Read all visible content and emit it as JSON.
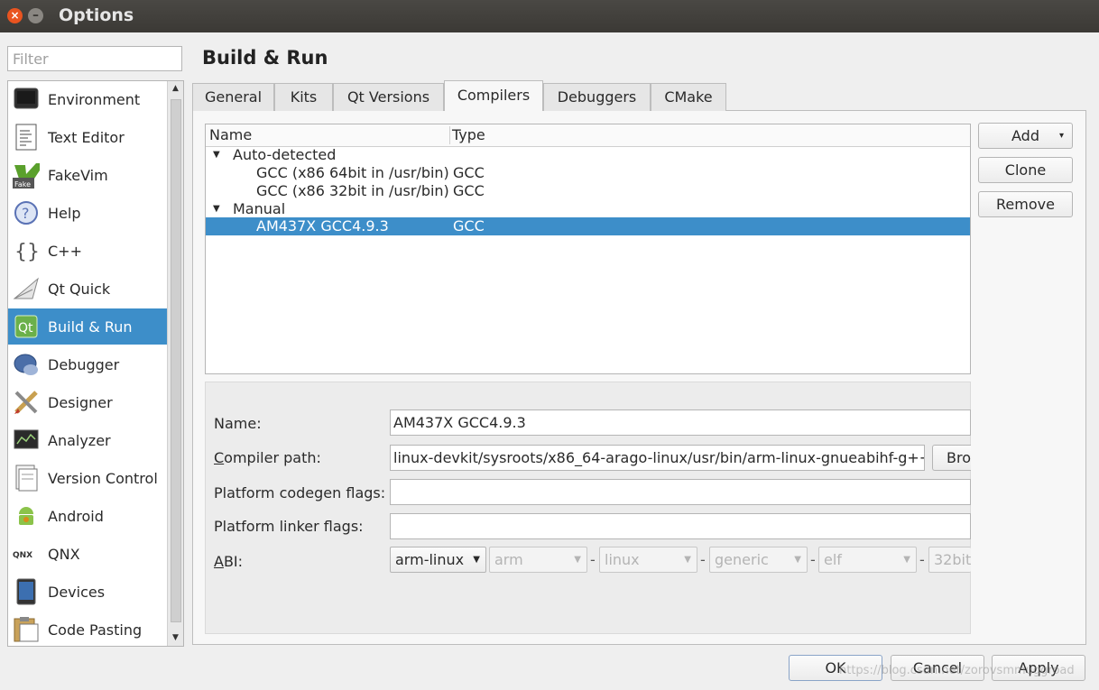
{
  "window": {
    "title": "Options"
  },
  "filter": {
    "placeholder": "Filter"
  },
  "sidebar": {
    "items": [
      {
        "label": "Environment"
      },
      {
        "label": "Text Editor"
      },
      {
        "label": "FakeVim",
        "icon_text": "Fake"
      },
      {
        "label": "Help"
      },
      {
        "label": "C++"
      },
      {
        "label": "Qt Quick"
      },
      {
        "label": "Build & Run",
        "selected": true
      },
      {
        "label": "Debugger"
      },
      {
        "label": "Designer"
      },
      {
        "label": "Analyzer"
      },
      {
        "label": "Version Control"
      },
      {
        "label": "Android"
      },
      {
        "label": "QNX",
        "icon_text": "QNX"
      },
      {
        "label": "Devices"
      },
      {
        "label": "Code Pasting"
      }
    ]
  },
  "page": {
    "title": "Build & Run"
  },
  "tabs": [
    {
      "label": "General"
    },
    {
      "label": "Kits"
    },
    {
      "label": "Qt Versions"
    },
    {
      "label": "Compilers",
      "active": true
    },
    {
      "label": "Debuggers"
    },
    {
      "label": "CMake"
    }
  ],
  "tree": {
    "columns": {
      "name": "Name",
      "type": "Type"
    },
    "groups": [
      {
        "label": "Auto-detected",
        "items": [
          {
            "name": "GCC (x86 64bit in /usr/bin)",
            "type": "GCC"
          },
          {
            "name": "GCC (x86 32bit in /usr/bin)",
            "type": "GCC"
          }
        ]
      },
      {
        "label": "Manual",
        "items": [
          {
            "name": "AM437X GCC4.9.3",
            "type": "GCC",
            "selected": true
          }
        ]
      }
    ]
  },
  "buttons": {
    "add": "Add",
    "clone": "Clone",
    "remove": "Remove"
  },
  "details": {
    "name_label": "Name:",
    "name_value": "AM437X GCC4.9.3",
    "compiler_path_label_prefix": "C",
    "compiler_path_label_rest": "ompiler path:",
    "compiler_path_value": "linux-devkit/sysroots/x86_64-arago-linux/usr/bin/arm-linux-gnueabihf-g++",
    "browse_label": "Bro",
    "codegen_label": "Platform codegen flags:",
    "codegen_value": "",
    "linker_label": "Platform linker flags:",
    "linker_value": "",
    "abi_label_prefix": "A",
    "abi_label_rest": "BI:",
    "abi": {
      "arch_select": "arm-linux",
      "arch": "arm",
      "os": "linux",
      "flavor": "generic",
      "format": "elf",
      "width": "32bit",
      "separator": "-"
    }
  },
  "footer": {
    "ok": "OK",
    "cancel": "Cancel",
    "apply": "Apply"
  },
  "watermark": "https://blog.csdn.net/zorovsmmuggroad",
  "colors": {
    "selection": "#3d8ec9",
    "titlebar": "#3b3935",
    "close_button": "#e95420"
  }
}
